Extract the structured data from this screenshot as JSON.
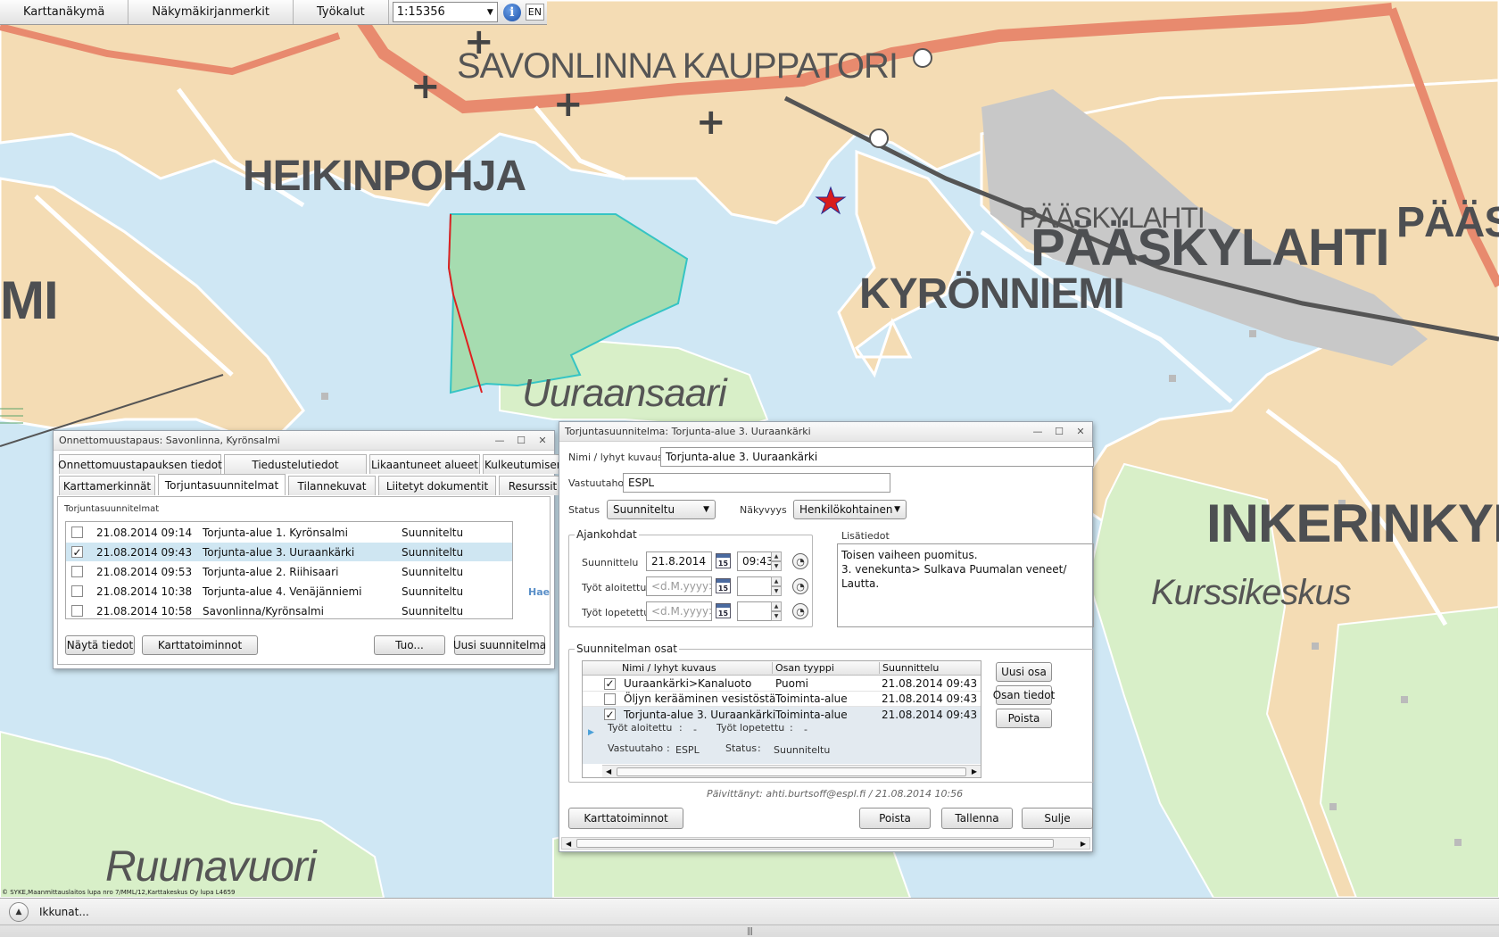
{
  "toolbar": {
    "map_view": "Karttanäkymä",
    "bookmarks": "Näkymäkirjanmerkit",
    "tools": "Työkalut",
    "scale": "1:15356",
    "lang": "EN"
  },
  "map": {
    "labels": {
      "savonlinna": "SAVONLINNA KAUPPATORI",
      "heikinpohja": "HEIKINPOHJA",
      "paaskylahti_small": "PÄÄSKYLAHTI",
      "paaskylahti": "PÄÄSKYLAHTI",
      "paas": "PÄÄS",
      "kyronniemi": "KYRÖNNIEMI",
      "mi": "MI",
      "uuraansaari": "Uuraansaari",
      "inkerinkyla": "INKERINKYLÄ",
      "kurssikeskus": "Kurssikeskus",
      "ruunavuori": "Ruunavuori"
    },
    "copyright": "© SYKE,Maanmittauslaitos lupa nro 7/MML/12,Karttakeskus Oy lupa L4659",
    "colors": {
      "water": "#cfe7f4",
      "land": "#f4dcb4",
      "road": "#e88a6e",
      "polygon": "#a6dcb0"
    }
  },
  "left_window": {
    "title": "Onnettomuustapaus: Savonlinna, Kyrönsalmi",
    "tabs_row1": [
      "Onnettomuustapauksen tiedot",
      "Tiedustelutiedot",
      "Likaantuneet alueet",
      "Kulkeutumisennusteet"
    ],
    "tabs_row2": [
      "Karttamerkinnät",
      "Torjuntasuunnitelmat",
      "Tilannekuvat",
      "Liitetyt dokumentit",
      "Resurssit"
    ],
    "active_tab": "Torjuntasuunnitelmat",
    "section": "Torjuntasuunnitelmat",
    "plans": [
      {
        "date": "21.08.2014 09:14",
        "name": "Torjunta-alue 1. Kyrönsalmi",
        "status": "Suunniteltu",
        "checked": false
      },
      {
        "date": "21.08.2014 09:43",
        "name": "Torjunta-alue 3. Uuraankärki",
        "status": "Suunniteltu",
        "checked": true
      },
      {
        "date": "21.08.2014 09:53",
        "name": "Torjunta-alue 2. Riihisaari",
        "status": "Suunniteltu",
        "checked": false
      },
      {
        "date": "21.08.2014 10:38",
        "name": "Torjunta-alue 4. Venäjänniemi",
        "status": "Suunniteltu",
        "checked": false
      },
      {
        "date": "21.08.2014 10:58",
        "name": "Savonlinna/Kyrönsalmi",
        "status": "Suunniteltu",
        "checked": false
      }
    ],
    "hae": "Hae",
    "buttons": {
      "show": "Näytä tiedot",
      "map_functions": "Karttatoiminnot",
      "import": "Tuo...",
      "new_plan": "Uusi suunnitelma"
    }
  },
  "right_window": {
    "title": "Torjuntasuunnitelma: Torjunta-alue 3. Uuraankärki",
    "name_label": "Nimi / lyhyt kuvaus",
    "name_value": "Torjunta-alue 3. Uuraankärki",
    "resp_label": "Vastuutaho",
    "resp_value": "ESPL",
    "status_label": "Status",
    "status_value": "Suunniteltu",
    "visibility_label": "Näkyvyys",
    "visibility_value": "Henkilökohtainen",
    "times_group": "Ajankohdat",
    "planned_label": "Suunnittelu",
    "planned_date": "21.8.2014",
    "planned_time": "09:43",
    "started_label": "Työt aloitettu",
    "ended_label": "Työt lopetettu",
    "date_placeholder": "<d.M.yyyy>",
    "notes_label": "Lisätiedot",
    "notes_line1": "Toisen vaiheen puomitus.",
    "notes_line2": "3. venekunta> Sulkava Puumalan veneet/ Lautta.",
    "parts_group": "Suunnitelman osat",
    "parts_headers": [
      "Nimi / lyhyt kuvaus",
      "Osan tyyppi",
      "Suunnittelu"
    ],
    "parts": [
      {
        "name": "Uuraankärki>Kanaluoto",
        "type": "Puomi",
        "planned": "21.08.2014 09:43",
        "checked": true
      },
      {
        "name": "Öljyn kerääminen vesistöstä",
        "type": "Toiminta-alue",
        "planned": "21.08.2014 09:43",
        "checked": false
      },
      {
        "name": "Torjunta-alue 3. Uuraankärki",
        "type": "Toiminta-alue",
        "planned": "21.08.2014 09:43",
        "checked": true
      }
    ],
    "detail": {
      "started_label": "Työt aloitettu",
      "started_value": "-",
      "ended_label": "Työt lopetettu",
      "ended_value": "-",
      "resp_label": "Vastuutaho",
      "resp_value": "ESPL",
      "status_label": "Status",
      "status_value": "Suunniteltu"
    },
    "part_buttons": {
      "new": "Uusi osa",
      "info": "Osan tiedot",
      "delete": "Poista"
    },
    "updated": "Päivittänyt: ahti.burtsoff@espl.fi / 21.08.2014 10:56",
    "buttons": {
      "map_functions": "Karttatoiminnot",
      "delete": "Poista",
      "save": "Tallenna",
      "close": "Sulje"
    }
  },
  "taskbar": {
    "windows": "Ikkunat..."
  }
}
